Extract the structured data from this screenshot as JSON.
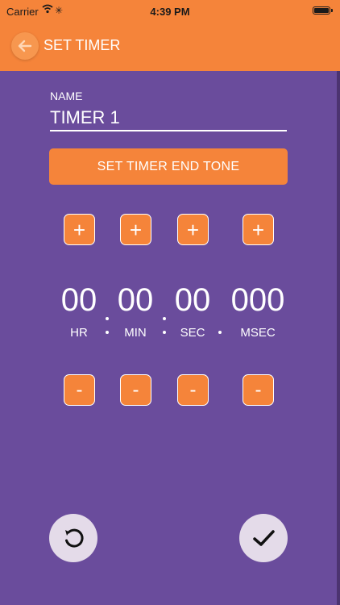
{
  "status_bar": {
    "carrier": "Carrier",
    "time": "4:39 PM"
  },
  "header": {
    "title": "SET TIMER",
    "back_icon": "back-arrow-icon"
  },
  "form": {
    "name_label": "NAME",
    "name_value": "TIMER 1",
    "tone_button_label": "SET TIMER END TONE"
  },
  "timer": {
    "plus_label": "+",
    "minus_label": "-",
    "fields": [
      {
        "value": "00",
        "unit": "HR"
      },
      {
        "value": "00",
        "unit": "MIN"
      },
      {
        "value": "00",
        "unit": "SEC"
      },
      {
        "value": "000",
        "unit": "MSEC"
      }
    ]
  },
  "actions": {
    "reset_icon": "reset-icon",
    "confirm_icon": "checkmark-icon"
  },
  "colors": {
    "accent": "#f5843a",
    "background": "#6a4c9c",
    "round_button": "#e4dbe9"
  }
}
